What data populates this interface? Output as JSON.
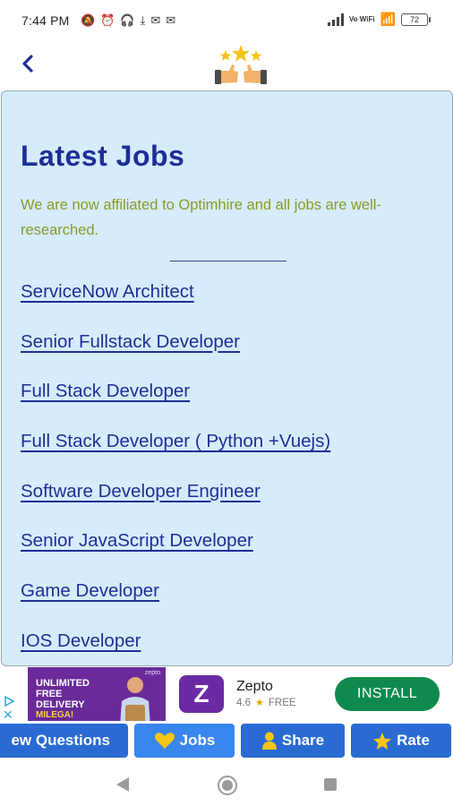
{
  "status_bar": {
    "time": "7:44 PM",
    "icons": [
      "dnd-off-icon",
      "alarm-icon",
      "headphones-icon",
      "download-icon",
      "mail-icon",
      "mail-icon"
    ],
    "vowifi": "Vo WiFi",
    "battery": "72"
  },
  "app_bar": {
    "back_icon": "chevron-left-icon",
    "logo_icon": "thumbs-up-stars-icon"
  },
  "jobs": {
    "title": "Latest Jobs",
    "intro": "We are now affiliated to Optimhire and all jobs are well-researched.",
    "items": [
      {
        "label": "ServiceNow Architect"
      },
      {
        "label": "Senior Fullstack Developer"
      },
      {
        "label": "Full Stack Developer"
      },
      {
        "label": "Full Stack Developer ( Python +Vuejs)"
      },
      {
        "label": "Software Developer Engineer"
      },
      {
        "label": "Senior JavaScript Developer"
      },
      {
        "label": "Game Developer"
      },
      {
        "label": "IOS Developer"
      }
    ]
  },
  "ad": {
    "image_text": "UNLIMITED FREE DELIVERY",
    "image_sub": "MILEGA!",
    "image_brand": "zepto",
    "app_icon_letter": "Z",
    "app_name": "Zepto",
    "rating": "4.6",
    "price": "FREE",
    "install_label": "INSTALL",
    "colors": {
      "install": "#0f8a4e",
      "app_icon": "#6b2aa3"
    }
  },
  "actions": {
    "questions": "ew Questions",
    "jobs": "Jobs",
    "share": "Share",
    "rate": "Rate"
  },
  "colors": {
    "accent": "#1e2f96",
    "card_bg": "#d6ecfd",
    "intro_text": "#8a9a22",
    "button": "#2a6bd3"
  }
}
